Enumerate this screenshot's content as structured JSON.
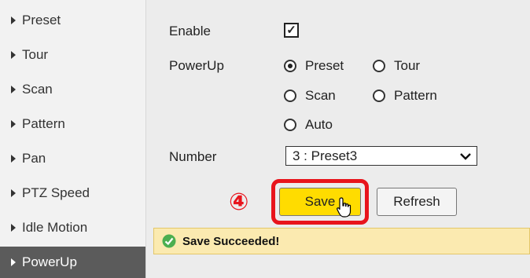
{
  "sidebar": {
    "items": [
      {
        "label": "Preset"
      },
      {
        "label": "Tour"
      },
      {
        "label": "Scan"
      },
      {
        "label": "Pattern"
      },
      {
        "label": "Pan"
      },
      {
        "label": "PTZ Speed"
      },
      {
        "label": "Idle Motion"
      },
      {
        "label": "PowerUp",
        "active": true
      }
    ]
  },
  "form": {
    "enable_label": "Enable",
    "enable_checked": true,
    "enable_check_glyph": "✓",
    "powerup_label": "PowerUp",
    "options": {
      "preset": "Preset",
      "tour": "Tour",
      "scan": "Scan",
      "pattern": "Pattern",
      "auto": "Auto"
    },
    "selected_option": "Preset",
    "number_label": "Number",
    "number_value": "3 : Preset3"
  },
  "actions": {
    "step_marker": "④",
    "save_label": "Save",
    "refresh_label": "Refresh"
  },
  "status": {
    "message": "Save Succeeded!"
  },
  "colors": {
    "highlight": "#e8141c",
    "save_button": "#ffdc00",
    "success_bg": "#fbeab0",
    "active_sidebar": "#5b5b5b"
  }
}
